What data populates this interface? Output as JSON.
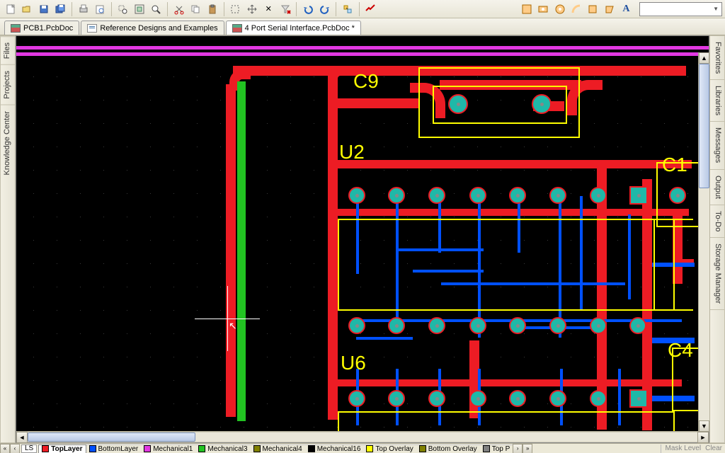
{
  "tabs": [
    {
      "label": "PCB1.PcbDoc",
      "icon": "pcb",
      "active": false
    },
    {
      "label": "Reference Designs and Examples",
      "icon": "doc",
      "active": false
    },
    {
      "label": "4 Port Serial Interface.PcbDoc *",
      "icon": "pcb",
      "active": true
    }
  ],
  "left_rail": [
    "Files",
    "Projects",
    "Knowledge Center"
  ],
  "right_rail": [
    "Favorites",
    "Libraries",
    "Messages",
    "Output",
    "To-Do",
    "Storage Manager"
  ],
  "designators": {
    "c9": "C9",
    "u2": "U2",
    "u6": "U6",
    "c1": "C1",
    "c4": "C4"
  },
  "layer_bar": {
    "ls": "LS",
    "layers": [
      {
        "name": "TopLayer",
        "color": "#ed1c24",
        "active": true
      },
      {
        "name": "BottomLayer",
        "color": "#0050ff",
        "active": false
      },
      {
        "name": "Mechanical1",
        "color": "#e238e2",
        "active": false
      },
      {
        "name": "Mechanical3",
        "color": "#22c322",
        "active": false
      },
      {
        "name": "Mechanical4",
        "color": "#808000",
        "active": false
      },
      {
        "name": "Mechanical16",
        "color": "#000000",
        "active": false
      },
      {
        "name": "Top Overlay",
        "color": "#ffff00",
        "active": false
      },
      {
        "name": "Bottom Overlay",
        "color": "#808000",
        "active": false
      },
      {
        "name": "Top P",
        "color": "#808080",
        "active": false
      }
    ],
    "arrow_left2": "«",
    "arrow_left": "‹",
    "arrow_right": "›",
    "arrow_right2": "»",
    "mask_level": "Mask Level",
    "clear": "Clear"
  }
}
